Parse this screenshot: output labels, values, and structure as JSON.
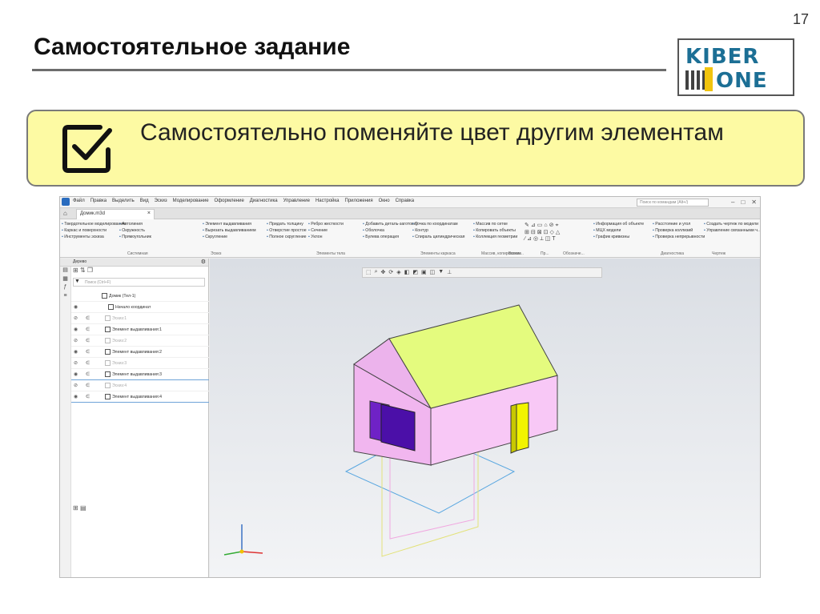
{
  "slide": {
    "number": "17",
    "title": "Самостоятельное задание",
    "task_text": "Самостоятельно поменяйте цвет другим элементам"
  },
  "logo": {
    "line1": "KIBER",
    "line2": "ONE",
    "brand_color": "#1c6f95",
    "accent_color": "#f1c40f"
  },
  "app": {
    "menu": [
      "Файл",
      "Правка",
      "Выделить",
      "Вид",
      "Эскиз",
      "Моделирование",
      "Оформление",
      "Диагностика",
      "Управление",
      "Настройка",
      "Приложения",
      "Окно",
      "Справка"
    ],
    "command_search_placeholder": "Поиск по командам (Alt+/)",
    "document_tab": "Домик.m3d",
    "ribbon": {
      "groups": [
        {
          "items": [
            "Твердотельное моделирование",
            "Каркас и поверхности",
            "Инструменты эскиза"
          ],
          "label": ""
        },
        {
          "items": [
            "Автолиния",
            "Окружность",
            "Прямоугольник"
          ],
          "label": "Системная"
        },
        {
          "items": [
            "Элемент выдавливания",
            "Вырезать выдавливанием",
            "Скругление"
          ],
          "label": "Эскиз"
        },
        {
          "items": [
            "Придать толщину",
            "Отверстие простое",
            "Полное скругление"
          ],
          "label": ""
        },
        {
          "items": [
            "Ребро жесткости",
            "Сечение",
            "Уклон"
          ],
          "label": "Элементы тела"
        },
        {
          "items": [
            "Добавить деталь-заготовку",
            "Оболочка",
            "Булева операция"
          ],
          "label": ""
        },
        {
          "items": [
            "Точка по координатам",
            "Контур",
            "Спираль цилиндрическая"
          ],
          "label": "Элементы каркаса"
        },
        {
          "items": [
            "Массив по сетке",
            "Копировать объекты",
            "Коллекция геометрии"
          ],
          "label": "Массив, копирование"
        },
        {
          "items": [
            "Информация об объекте",
            "МЦХ модели",
            "График кривизны"
          ],
          "label": ""
        },
        {
          "items": [
            "Расстояние и угол",
            "Проверка коллизий",
            "Проверка непрерывности"
          ],
          "label": "Диагностика"
        },
        {
          "items": [
            "Создать чертеж по модели",
            "Управление связанными ч..."
          ],
          "label": "Чертеж"
        }
      ],
      "mini_labels": [
        "Вспом...",
        "Пр...",
        "Обозначе..."
      ]
    },
    "tree": {
      "title": "Дерево",
      "search_placeholder": "Поиск (Ctrl+F)",
      "root": "Домик (Тел-1)",
      "items": [
        {
          "label": "Начало координат",
          "muted": false
        },
        {
          "label": "Эскиз:1",
          "muted": true
        },
        {
          "label": "Элемент выдавливания:1",
          "muted": false
        },
        {
          "label": "Эскиз:2",
          "muted": true
        },
        {
          "label": "Элемент выдавливания:2",
          "muted": false
        },
        {
          "label": "Эскиз:3",
          "muted": true
        },
        {
          "label": "Элемент выдавливания:3",
          "muted": false
        },
        {
          "label": "Эскиз:4",
          "muted": true
        },
        {
          "label": "Элемент выдавливания:4",
          "muted": false
        }
      ]
    },
    "model_colors": {
      "roof": "#e4fb7e",
      "walls": "#f8c8f6",
      "window": "#4b0fa8",
      "door": "#f2f400"
    }
  }
}
